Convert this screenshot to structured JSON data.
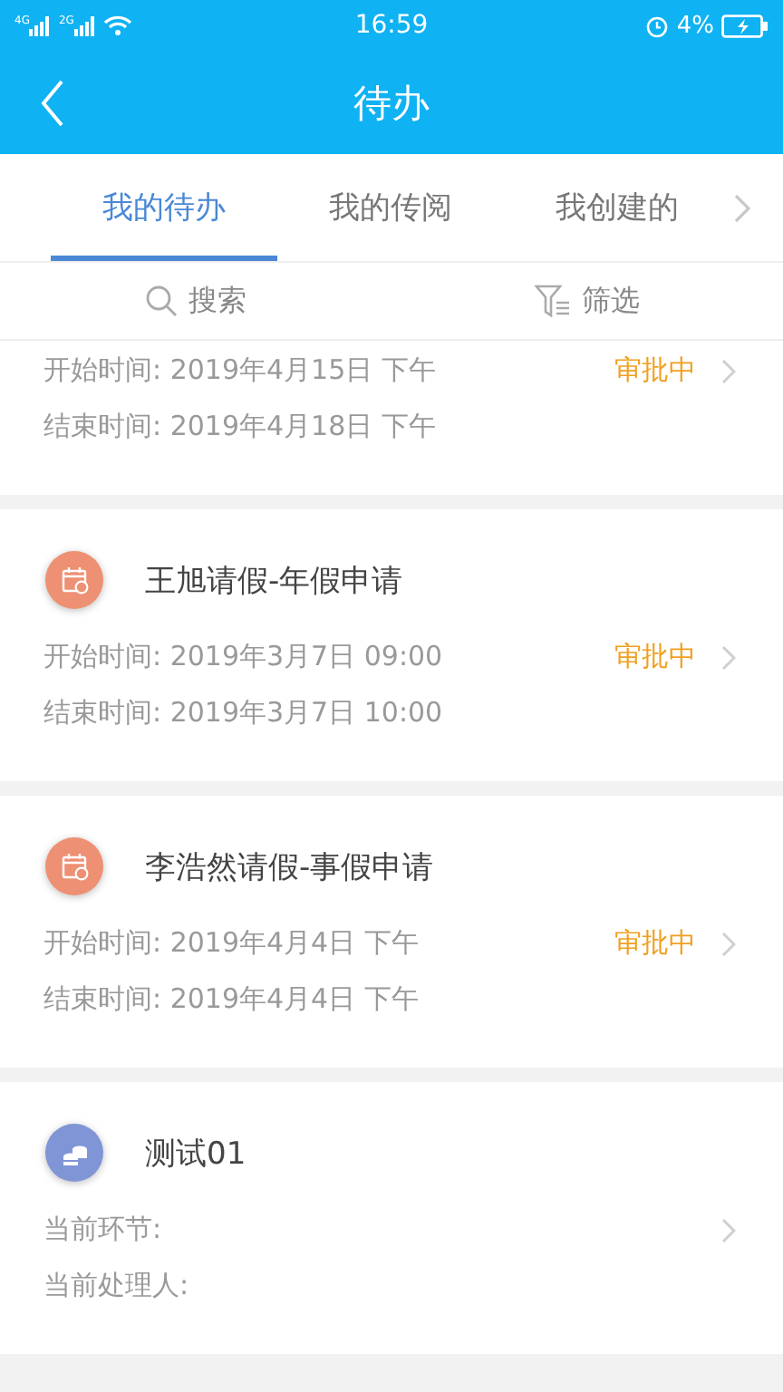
{
  "status_bar": {
    "time": "16:59",
    "network_1": "4G",
    "network_2": "2G",
    "battery": "4%"
  },
  "header": {
    "title": "待办"
  },
  "tabs": [
    {
      "label": "我的待办",
      "selected": true
    },
    {
      "label": "我的传阅",
      "selected": false
    },
    {
      "label": "我创建的",
      "selected": false
    }
  ],
  "toolbar": {
    "search": "搜索",
    "filter": "筛选"
  },
  "items": [
    {
      "lines": [
        "开始时间: 2019年4月15日 下午",
        "结束时间: 2019年4月18日 下午"
      ],
      "status": "审批中"
    },
    {
      "kind": "leave",
      "title": "王旭请假-年假申请",
      "lines": [
        "开始时间: 2019年3月7日 09:00",
        "结束时间: 2019年3月7日 10:00"
      ],
      "status": "审批中"
    },
    {
      "kind": "leave",
      "title": "李浩然请假-事假申请",
      "lines": [
        "开始时间: 2019年4月4日 下午",
        "结束时间: 2019年4月4日 下午"
      ],
      "status": "审批中"
    },
    {
      "kind": "finance",
      "title": "测试01",
      "lines": [
        "当前环节:",
        "当前处理人:"
      ]
    }
  ]
}
